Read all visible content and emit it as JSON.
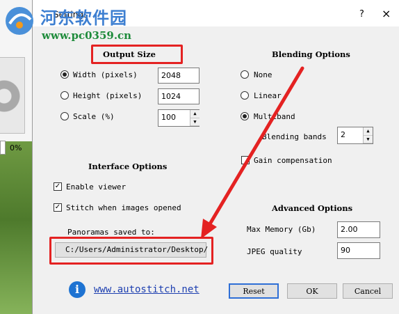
{
  "watermark": {
    "title": "河东软件园",
    "url": "www.pc0359.cn"
  },
  "background_app": {
    "progress_percent": "0%"
  },
  "dialog": {
    "title": "Settings",
    "help_label": "?",
    "close_label": "×"
  },
  "output_size": {
    "heading": "Output Size",
    "options": [
      {
        "label": "Width (pixels)",
        "value": "2048",
        "selected": true
      },
      {
        "label": "Height (pixels)",
        "value": "1024",
        "selected": false
      },
      {
        "label": "Scale (%)",
        "value": "100",
        "selected": false
      }
    ]
  },
  "blending": {
    "heading": "Blending Options",
    "options": [
      {
        "label": "None",
        "selected": false
      },
      {
        "label": "Linear",
        "selected": false
      },
      {
        "label": "Multiband",
        "selected": true
      }
    ],
    "bands_label": "Blending bands",
    "bands_value": "2",
    "gain_label": "Gain compensation",
    "gain_checked": false
  },
  "interface": {
    "heading": "Interface Options",
    "enable_viewer_label": "Enable viewer",
    "enable_viewer_checked": true,
    "stitch_label": "Stitch when images opened",
    "stitch_checked": true,
    "saved_to_label": "Panoramas saved to:",
    "saved_to_path": "C:/Users/Administrator/Desktop/"
  },
  "advanced": {
    "heading": "Advanced Options",
    "max_memory_label": "Max Memory (Gb)",
    "max_memory_value": "2.00",
    "jpeg_label": "JPEG quality",
    "jpeg_value": "90"
  },
  "footer": {
    "link_text": "www.autostitch.net",
    "reset_label": "Reset",
    "ok_label": "OK",
    "cancel_label": "Cancel"
  },
  "colors": {
    "annotation_red": "#e42222",
    "link_blue": "#1d3fb0",
    "info_blue": "#1e73d2"
  }
}
